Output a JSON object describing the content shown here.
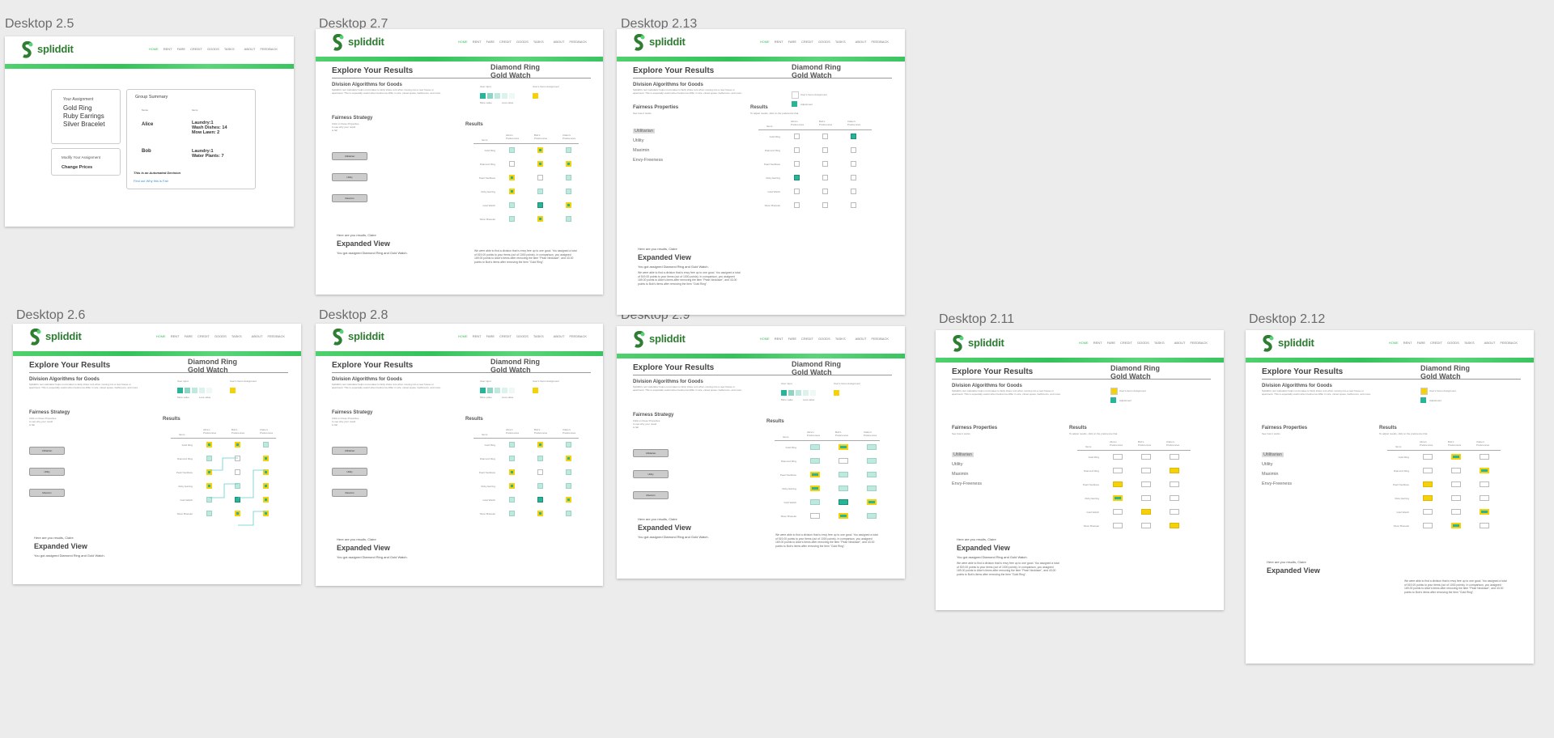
{
  "frames": [
    {
      "name": "Desktop 2.5"
    },
    {
      "name": "Desktop 2.7"
    },
    {
      "name": "Desktop 2.13"
    },
    {
      "name": "Desktop 2.6"
    },
    {
      "name": "Desktop 2.8"
    },
    {
      "name": "Desktop 2.9"
    },
    {
      "name": "Desktop 2.11"
    },
    {
      "name": "Desktop 2.12"
    }
  ],
  "app": {
    "logo": "spliddit",
    "nav": [
      "HOME",
      "RENT",
      "FARE",
      "CREDIT",
      "GOODS",
      "TASKS",
      "ABOUT",
      "FEEDBACK"
    ]
  },
  "summary": {
    "your_assignment": "Your Assignment",
    "items": [
      "Gold Ring",
      "Ruby Earrings",
      "Silver Bracelet"
    ],
    "modify": "Modify Your Assignment",
    "change_prices": "Change Prices",
    "group_summary": "Group Summary",
    "col_name": "Name",
    "col_items": "Items",
    "people": [
      {
        "name": "Alice",
        "items": "Laundry:1\nWash Dishes: 14\nMow Lawn: 2"
      },
      {
        "name": "Bob",
        "items": "Laundry:1\nWater Plants: 7"
      }
    ],
    "automated": "This is an Automated Decision",
    "why_link": "Find out Why this is Fair"
  },
  "results": {
    "title": "Explore Your Results",
    "assigned": "Diamond Ring\nGold Watch",
    "algo_title": "Division Algorithms for Goods",
    "algo_desc": "Spliddit's rent calculator helps roommates to fairly share rent when moving into a new house or apartment. This is especially useful when bedrooms differ in size, closet space, bathrooms, and more.",
    "user_input": "User input",
    "more_value": "More value",
    "less_value": "Less value",
    "user_items": "User's Items Assignment",
    "adjustment": "Adjustment",
    "fairness_strategy": "Fairness Strategy",
    "fairness_hint": "Click on these Properties\nto see why your result\nis fair",
    "strategies": [
      "Utilitarian",
      "Utility",
      "Maximin"
    ],
    "fairness_properties": "Fairness Properties",
    "props_hint": "See how it works",
    "properties": [
      "Utilitarian",
      "Utility",
      "Maximin",
      "Envy-Freeness"
    ],
    "results_label": "Results",
    "results_hint": "To adjust results, click on the preference that",
    "col_items": "Items",
    "cols": [
      "Alice's Preferences",
      "Bob's Preferences",
      "Claire's Preferences"
    ],
    "rows": [
      "Gold Ring",
      "Diamond Ring",
      "Pearl Necklace",
      "Ruby Earring",
      "Gold Watch",
      "Silver Bracelet"
    ],
    "here": "Here are you results, Claire",
    "expanded": "Expanded View",
    "you_got": "You got assigned Diamond Ring and Gold Watch.",
    "explain": "We were able to find a division that is envy free up to one good. You assigned a total of 519.00 points to your items (out of 1000 points). In comparison, you assigned 169.00 points to Alice's items after removing the item \"Pearl Necklace\", and 43.00 points to Bob's items after removing the item \"Gold Ring\"."
  }
}
